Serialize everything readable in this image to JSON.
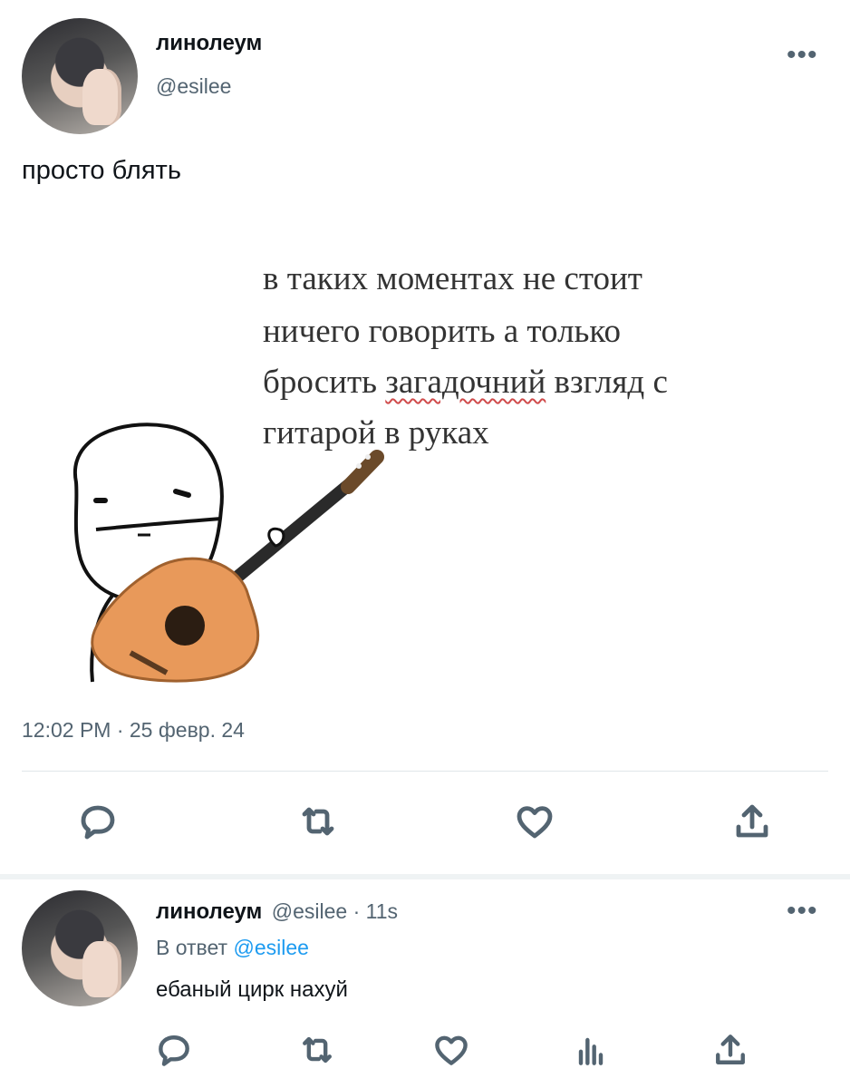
{
  "main_tweet": {
    "display_name": "линолеум",
    "handle": "@esilee",
    "more_label": "•••",
    "text": "просто блять",
    "meme": {
      "line1": "в таких моментах не стоит",
      "line2": "ничего говорить а только",
      "line3_before": "бросить ",
      "line3_marked": "загадочний",
      "line3_after": " взгляд с",
      "line4": "гитарой в руках"
    },
    "timestamp": "12:02 PM · 25 февр. 24",
    "actions": [
      "reply-icon",
      "retweet-icon",
      "like-icon",
      "share-icon"
    ]
  },
  "reply_tweet": {
    "display_name": "линолеум",
    "handle_time": "@esilee · 11s",
    "more_label": "•••",
    "reply_prefix": "В ответ",
    "reply_to": "@esilee",
    "text": "ебаный цирк нахуй",
    "actions": [
      "reply-icon",
      "retweet-icon",
      "like-icon",
      "views-icon",
      "share-icon"
    ]
  },
  "colors": {
    "text": "#0f1419",
    "secondary": "#536471",
    "link": "#1d9bf0",
    "divider": "#e1e6ea",
    "guitar": "#e8995a"
  }
}
